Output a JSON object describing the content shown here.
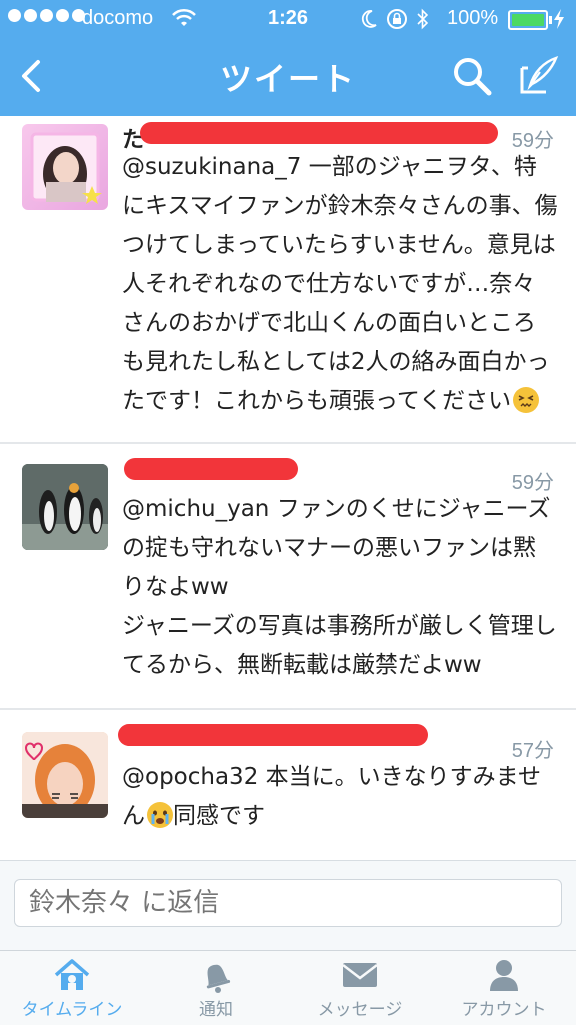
{
  "status": {
    "carrier": "docomo",
    "time": "1:26",
    "battery": "100%"
  },
  "nav": {
    "title": "ツイート"
  },
  "tweets": [
    {
      "name": "た",
      "time": "59分",
      "text": "@suzukinana_7 一部のジャニヲタ、特にキスマイファンが鈴木奈々さんの事、傷つけてしまっていたらすいません。意見は人それぞれなので仕方ないですが…奈々さんのおかげで北山くんの面白いところも見れたし私としては2人の絡み面白かったです！これからも頑張ってください",
      "emoji": "persevering-face"
    },
    {
      "time": "59分",
      "text": "@michu_yan ファンのくせにジャニーズの掟も守れないマナーの悪いファンは黙りなよww\nジャニーズの写真は事務所が厳しく管理してるから、無断転載は厳禁だよww"
    },
    {
      "time": "57分",
      "text_before": "@opocha32 本当に。いきなりすみません",
      "emoji": "crying-face",
      "text_after": "同感です"
    }
  ],
  "reply": {
    "placeholder": "鈴木奈々 に返信"
  },
  "tabs": [
    {
      "label": "タイムライン",
      "icon": "home-icon",
      "active": true
    },
    {
      "label": "通知",
      "icon": "bell-icon",
      "active": false
    },
    {
      "label": "メッセージ",
      "icon": "envelope-icon",
      "active": false
    },
    {
      "label": "アカウント",
      "icon": "person-icon",
      "active": false
    }
  ],
  "colors": {
    "brand": "#55acee",
    "redaction": "#f2353a",
    "battery": "#4cd964",
    "muted": "#8899a6"
  }
}
